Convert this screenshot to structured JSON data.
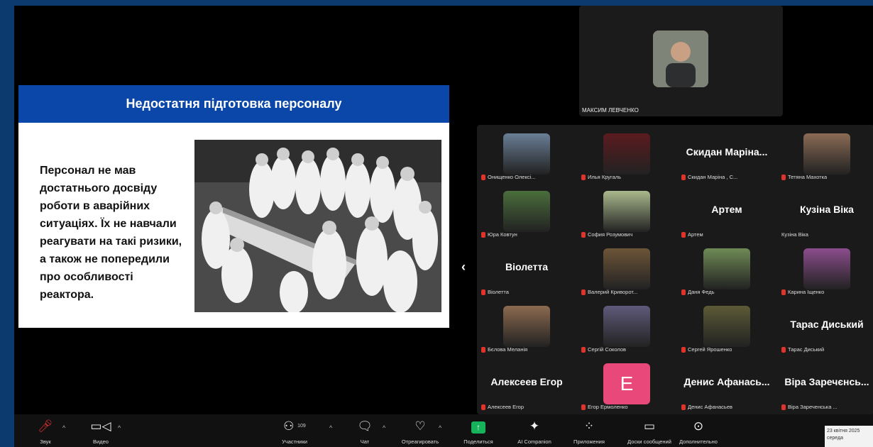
{
  "slide": {
    "title": "Недостатня підготовка персоналу",
    "body": "Персонал не мав достатнього досвіду роботи в аварійних ситуаціях. Їх не навчали реагувати на такі ризики, а також не попередили про особливості реактора."
  },
  "top_video": {
    "name": "МАКСИМ ЛЕВЧЕНКО"
  },
  "gallery": {
    "tiles": [
      {
        "label": "Онищенко Олексі...",
        "display": "",
        "muted": true,
        "pic": "#6a7f96"
      },
      {
        "label": "Илья Кругаль",
        "display": "",
        "muted": true,
        "pic": "#5b1b1f"
      },
      {
        "label": "Скидан Маріна , С...",
        "display": "Скидан Маріна...",
        "muted": true,
        "pic": ""
      },
      {
        "label": "Тетяна Махотка",
        "display": "",
        "muted": true,
        "pic": "#8a6b55"
      },
      {
        "label": "Юра Ковтун",
        "display": "",
        "muted": true,
        "pic": "#4a6e3b"
      },
      {
        "label": "София Розумович",
        "display": "",
        "muted": true,
        "pic": "#a9b88c"
      },
      {
        "label": "Артем",
        "display": "Артем",
        "muted": true,
        "pic": ""
      },
      {
        "label": "Кузіна Віка",
        "display": "Кузіна Віка",
        "muted": false,
        "pic": ""
      },
      {
        "label": "Віолетта",
        "display": "Віолетта",
        "muted": true,
        "pic": ""
      },
      {
        "label": "Валерий Криворот...",
        "display": "",
        "muted": true,
        "pic": "#6d5538"
      },
      {
        "label": "Даня Федь",
        "display": "",
        "muted": true,
        "pic": "#6f8a55"
      },
      {
        "label": "Карина Іщенко",
        "display": "",
        "muted": true,
        "pic": "#8b4d8c"
      },
      {
        "label": "Бєлова Меланія",
        "display": "",
        "muted": true,
        "pic": "#8c6a4f"
      },
      {
        "label": "Сергій Соколов",
        "display": "",
        "muted": true,
        "pic": "#5f5a7a"
      },
      {
        "label": "Сергей Ярошенко",
        "display": "",
        "muted": true,
        "pic": "#5c5a36"
      },
      {
        "label": "Тарас Диський",
        "display": "Тарас Диський",
        "muted": true,
        "pic": ""
      },
      {
        "label": "Алексеев Егор",
        "display": "Алексеев Егор",
        "muted": true,
        "pic": ""
      },
      {
        "label": "Егор Ермоленко",
        "display": "",
        "muted": true,
        "pic": "",
        "letter": "E"
      },
      {
        "label": "Денис Афанасьев",
        "display": "Денис Афанась...",
        "muted": true,
        "pic": ""
      },
      {
        "label": "Віра Зареченська ...",
        "display": "Віра Заречєнсь...",
        "muted": true,
        "pic": ""
      }
    ]
  },
  "toolbar": {
    "sound": "Звук",
    "video": "Видео",
    "participants": "Участники",
    "participants_count": "109",
    "chat": "Чат",
    "react": "Отреагировать",
    "share": "Поделиться",
    "ai": "AI Companion",
    "apps": "Приложения",
    "boards": "Доски сообщений",
    "more": "Дополнительно"
  },
  "clock": {
    "date": "23 квітня 2025",
    "day": "середа"
  },
  "icons": [
    "mic-muted-icon",
    "video-camera-icon",
    "participants-icon",
    "chat-icon",
    "reaction-icon",
    "share-icon",
    "ai-sparkle-icon",
    "apps-icon",
    "whiteboard-icon",
    "more-icon",
    "chevron-left-icon"
  ]
}
